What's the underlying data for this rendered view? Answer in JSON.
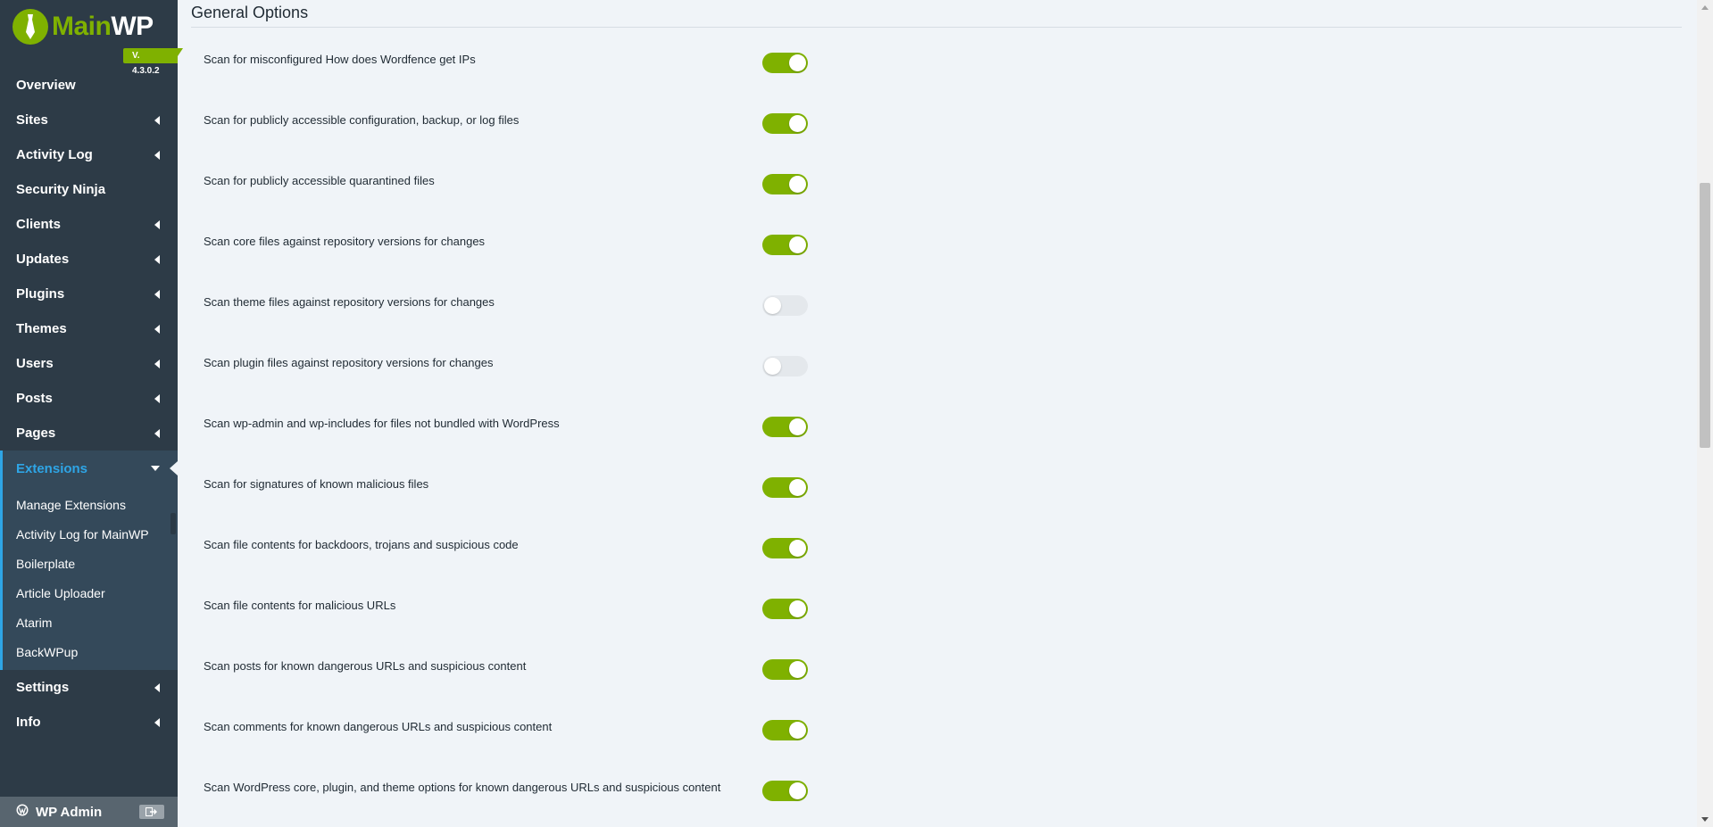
{
  "brand": {
    "name_part1": "Main",
    "name_part2": "WP",
    "version": "V. 4.3.0.2",
    "accent": "#7fb100"
  },
  "sidebar": {
    "items": [
      {
        "label": "Overview",
        "has_caret": false
      },
      {
        "label": "Sites",
        "has_caret": true
      },
      {
        "label": "Activity Log",
        "has_caret": true
      },
      {
        "label": "Security Ninja",
        "has_caret": false
      },
      {
        "label": "Clients",
        "has_caret": true
      },
      {
        "label": "Updates",
        "has_caret": true
      },
      {
        "label": "Plugins",
        "has_caret": true
      },
      {
        "label": "Themes",
        "has_caret": true
      },
      {
        "label": "Users",
        "has_caret": true
      },
      {
        "label": "Posts",
        "has_caret": true
      },
      {
        "label": "Pages",
        "has_caret": true
      }
    ],
    "active": {
      "label": "Extensions"
    },
    "submenu": [
      "Manage Extensions",
      "Activity Log for MainWP",
      "Boilerplate",
      "Article Uploader",
      "Atarim",
      "BackWPup"
    ],
    "items_after": [
      {
        "label": "Settings",
        "has_caret": true
      },
      {
        "label": "Info",
        "has_caret": true
      }
    ],
    "footer": {
      "label": "WP Admin"
    }
  },
  "main": {
    "section_title": "General Options",
    "options": [
      {
        "label": "Scan for misconfigured How does Wordfence get IPs",
        "enabled": true
      },
      {
        "label": "Scan for publicly accessible configuration, backup, or log files",
        "enabled": true
      },
      {
        "label": "Scan for publicly accessible quarantined files",
        "enabled": true
      },
      {
        "label": "Scan core files against repository versions for changes",
        "enabled": true
      },
      {
        "label": "Scan theme files against repository versions for changes",
        "enabled": false
      },
      {
        "label": "Scan plugin files against repository versions for changes",
        "enabled": false
      },
      {
        "label": "Scan wp-admin and wp-includes for files not bundled with WordPress",
        "enabled": true
      },
      {
        "label": "Scan for signatures of known malicious files",
        "enabled": true
      },
      {
        "label": "Scan file contents for backdoors, trojans and suspicious code",
        "enabled": true
      },
      {
        "label": "Scan file contents for malicious URLs",
        "enabled": true
      },
      {
        "label": "Scan posts for known dangerous URLs and suspicious content",
        "enabled": true
      },
      {
        "label": "Scan comments for known dangerous URLs and suspicious content",
        "enabled": true
      },
      {
        "label": "Scan WordPress core, plugin, and theme options for known dangerous URLs and suspicious content",
        "enabled": true
      }
    ]
  }
}
